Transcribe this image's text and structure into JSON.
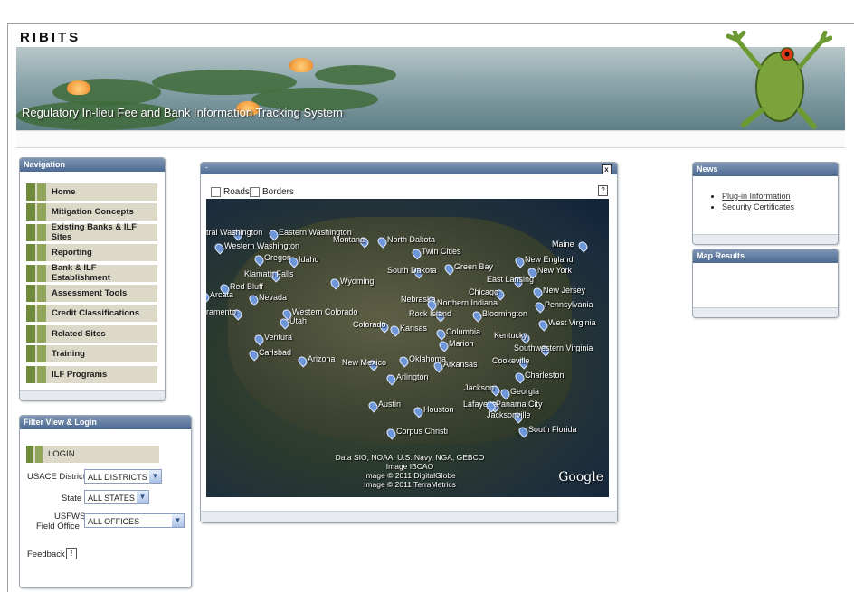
{
  "app": {
    "title": "RIBITS",
    "banner_subtitle": "Regulatory In-lieu Fee and Bank Information Tracking System"
  },
  "navigation": {
    "header": "Navigation",
    "items": [
      {
        "label": "Home"
      },
      {
        "label": "Mitigation Concepts"
      },
      {
        "label": "Existing Banks & ILF Sites"
      },
      {
        "label": "Reporting"
      },
      {
        "label": "Bank & ILF Establishment"
      },
      {
        "label": "Assessment Tools"
      },
      {
        "label": "Credit Classifications"
      },
      {
        "label": "Related Sites"
      },
      {
        "label": "Training"
      },
      {
        "label": "ILF Programs"
      }
    ]
  },
  "filter": {
    "header": "Filter View & Login",
    "login_label": "LOGIN",
    "district_label": "USACE District",
    "district_value": "ALL DISTRICTS",
    "state_label": "State",
    "state_value": "ALL STATES",
    "office_label_1": "USFWS",
    "office_label_2": "Field Office",
    "office_value": "ALL OFFICES",
    "feedback_label": "Feedback"
  },
  "map": {
    "title": "-",
    "close_symbol": "x",
    "roads_label": "Roads",
    "borders_label": "Borders",
    "help_symbol": "?",
    "labels": [
      "tral Washington",
      "Eastern Washington",
      "Western Washington",
      "Montana",
      "North Dakota",
      "Twin Cities",
      "Maine",
      "Oregon",
      "Idaho",
      "South Dakota",
      "Green Bay",
      "New England",
      "Klamath Falls",
      "Wyoming",
      "New York",
      "East Lansing",
      "Red Bluff",
      "Arcata",
      "Chicago",
      "New Jersey",
      "Nevada",
      "Nebraska",
      "Northern Indiana",
      "Pennsylvania",
      "ramento",
      "Utah",
      "Western Colorado",
      "Rock Island",
      "Bloomington",
      "West Virginia",
      "Colorado",
      "Kansas",
      "Columbia",
      "Kentucky",
      "Ventura",
      "Marion",
      "Southwestern Virginia",
      "Carlsbad",
      "Arizona",
      "New Mexico",
      "Oklahoma",
      "Arkansas",
      "Cookeville",
      "Arlington",
      "Charleston",
      "Jackson",
      "Georgia",
      "Austin",
      "Lafayette",
      "Panama City",
      "Houston",
      "Jacksonville",
      "South Florida",
      "Corpus Christi"
    ],
    "credits": [
      "Data SIO, NOAA, U.S. Navy, NGA, GEBCO",
      "Image IBCAO",
      "Image © 2011 DigitalGlobe",
      "Image © 2011 TerraMetrics"
    ],
    "google_logo": "Google"
  },
  "news": {
    "header": "News",
    "links": [
      "Plug-in Information",
      "Security Certificates"
    ]
  },
  "map_results": {
    "header": "Map Results"
  }
}
